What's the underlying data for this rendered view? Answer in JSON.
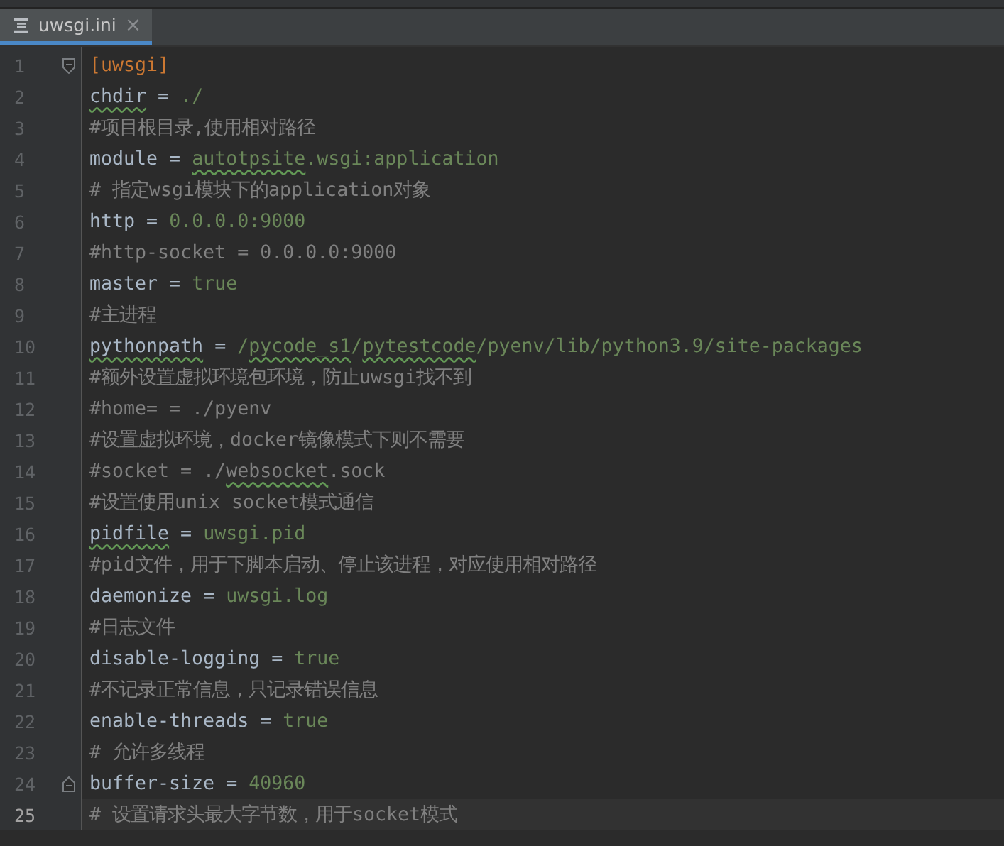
{
  "tabs": [
    {
      "label": "uwsgi.ini",
      "selected": true,
      "close": "×"
    }
  ],
  "lines": [
    {
      "number": "1",
      "fold_start": true,
      "current": false,
      "segments": [
        {
          "kind": "section",
          "text": "[uwsgi]"
        }
      ]
    },
    {
      "number": "2",
      "current": false,
      "segments": [
        {
          "kind": "key",
          "text": "chdir",
          "typo": true
        },
        {
          "kind": "op",
          "text": " = "
        },
        {
          "kind": "value",
          "text": "./"
        }
      ]
    },
    {
      "number": "3",
      "current": false,
      "segments": [
        {
          "kind": "comment",
          "text": "#项目根目录,使用相对路径"
        }
      ]
    },
    {
      "number": "4",
      "current": false,
      "segments": [
        {
          "kind": "key",
          "text": "module"
        },
        {
          "kind": "op",
          "text": " = "
        },
        {
          "kind": "value",
          "text": "autotpsite",
          "typo": true
        },
        {
          "kind": "value",
          "text": ".wsgi:application"
        }
      ]
    },
    {
      "number": "5",
      "current": false,
      "segments": [
        {
          "kind": "comment",
          "text": "# 指定wsgi模块下的application对象"
        }
      ]
    },
    {
      "number": "6",
      "current": false,
      "segments": [
        {
          "kind": "key",
          "text": "http"
        },
        {
          "kind": "op",
          "text": " = "
        },
        {
          "kind": "value",
          "text": "0.0.0.0:9000"
        }
      ]
    },
    {
      "number": "7",
      "current": false,
      "segments": [
        {
          "kind": "comment",
          "text": "#http-socket = 0.0.0.0:9000"
        }
      ]
    },
    {
      "number": "8",
      "current": false,
      "segments": [
        {
          "kind": "key",
          "text": "master"
        },
        {
          "kind": "op",
          "text": " = "
        },
        {
          "kind": "value",
          "text": "true"
        }
      ]
    },
    {
      "number": "9",
      "current": false,
      "segments": [
        {
          "kind": "comment",
          "text": "#主进程"
        }
      ]
    },
    {
      "number": "10",
      "current": false,
      "segments": [
        {
          "kind": "key",
          "text": "pythonpath",
          "typo": true
        },
        {
          "kind": "op",
          "text": " = "
        },
        {
          "kind": "value",
          "text": "/"
        },
        {
          "kind": "value",
          "text": "pycode_s1",
          "typo": true
        },
        {
          "kind": "value",
          "text": "/"
        },
        {
          "kind": "value",
          "text": "pytestcode",
          "typo": true
        },
        {
          "kind": "value",
          "text": "/pyenv/lib/python3.9/site-packages"
        }
      ]
    },
    {
      "number": "11",
      "current": false,
      "segments": [
        {
          "kind": "comment",
          "text": "#额外设置虚拟环境包环境，防止uwsgi找不到"
        }
      ]
    },
    {
      "number": "12",
      "current": false,
      "segments": [
        {
          "kind": "comment",
          "text": "#home= = ./pyenv"
        }
      ]
    },
    {
      "number": "13",
      "current": false,
      "segments": [
        {
          "kind": "comment",
          "text": "#设置虚拟环境，docker镜像模式下则不需要"
        }
      ]
    },
    {
      "number": "14",
      "current": false,
      "segments": [
        {
          "kind": "comment",
          "text": "#socket = ./"
        },
        {
          "kind": "comment",
          "text": "websocket",
          "typo": true
        },
        {
          "kind": "comment",
          "text": ".sock"
        }
      ]
    },
    {
      "number": "15",
      "current": false,
      "segments": [
        {
          "kind": "comment",
          "text": "#设置使用unix socket模式通信"
        }
      ]
    },
    {
      "number": "16",
      "current": false,
      "segments": [
        {
          "kind": "key",
          "text": "pidfile",
          "typo": true
        },
        {
          "kind": "op",
          "text": " = "
        },
        {
          "kind": "value",
          "text": "uwsgi.pid"
        }
      ]
    },
    {
      "number": "17",
      "current": false,
      "segments": [
        {
          "kind": "comment",
          "text": "#pid文件，用于下脚本启动、停止该进程，对应使用相对路径"
        }
      ]
    },
    {
      "number": "18",
      "current": false,
      "segments": [
        {
          "kind": "key",
          "text": "daemonize"
        },
        {
          "kind": "op",
          "text": " = "
        },
        {
          "kind": "value",
          "text": "uwsgi.log"
        }
      ]
    },
    {
      "number": "19",
      "current": false,
      "segments": [
        {
          "kind": "comment",
          "text": "#日志文件"
        }
      ]
    },
    {
      "number": "20",
      "current": false,
      "segments": [
        {
          "kind": "key",
          "text": "disable-logging"
        },
        {
          "kind": "op",
          "text": " = "
        },
        {
          "kind": "value",
          "text": "true"
        }
      ]
    },
    {
      "number": "21",
      "current": false,
      "segments": [
        {
          "kind": "comment",
          "text": "#不记录正常信息，只记录错误信息"
        }
      ]
    },
    {
      "number": "22",
      "current": false,
      "segments": [
        {
          "kind": "key",
          "text": "enable-threads"
        },
        {
          "kind": "op",
          "text": " = "
        },
        {
          "kind": "value",
          "text": "true"
        }
      ]
    },
    {
      "number": "23",
      "current": false,
      "segments": [
        {
          "kind": "comment",
          "text": "# 允许多线程"
        }
      ]
    },
    {
      "number": "24",
      "fold_end": true,
      "current": false,
      "segments": [
        {
          "kind": "key",
          "text": "buffer-size"
        },
        {
          "kind": "op",
          "text": " = "
        },
        {
          "kind": "value",
          "text": "40960"
        }
      ]
    },
    {
      "number": "25",
      "current": true,
      "segments": [
        {
          "kind": "comment",
          "text": "# 设置请求头最大字节数，用于socket模式"
        }
      ]
    }
  ]
}
